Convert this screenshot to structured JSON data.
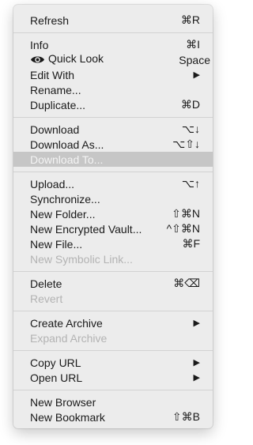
{
  "menu": {
    "refresh": {
      "label": "Refresh",
      "shortcut": "⌘R"
    },
    "info": {
      "label": "Info",
      "shortcut": "⌘I"
    },
    "quick_look": {
      "label": "Quick Look",
      "shortcut": "Space",
      "icon": "eye-icon"
    },
    "edit_with": {
      "label": "Edit With",
      "submenu_icon": "chevron-right-icon"
    },
    "rename": {
      "label": "Rename..."
    },
    "duplicate": {
      "label": "Duplicate...",
      "shortcut": "⌘D"
    },
    "download": {
      "label": "Download",
      "shortcut": "⌥↓"
    },
    "download_as": {
      "label": "Download As...",
      "shortcut": "⌥⇧↓"
    },
    "download_to": {
      "label": "Download To...",
      "state": "highlighted-disabled"
    },
    "upload": {
      "label": "Upload...",
      "shortcut": "⌥↑"
    },
    "synchronize": {
      "label": "Synchronize..."
    },
    "new_folder": {
      "label": "New Folder...",
      "shortcut": "⇧⌘N"
    },
    "new_encrypted_vault": {
      "label": "New Encrypted Vault...",
      "shortcut": "^⇧⌘N"
    },
    "new_file": {
      "label": "New File...",
      "shortcut": "⌘F"
    },
    "new_symbolic_link": {
      "label": "New Symbolic Link...",
      "state": "disabled"
    },
    "delete": {
      "label": "Delete",
      "shortcut": "⌘⌫"
    },
    "revert": {
      "label": "Revert",
      "state": "disabled"
    },
    "create_archive": {
      "label": "Create Archive",
      "submenu_icon": "chevron-right-icon"
    },
    "expand_archive": {
      "label": "Expand Archive",
      "state": "disabled"
    },
    "copy_url": {
      "label": "Copy URL",
      "submenu_icon": "chevron-right-icon"
    },
    "open_url": {
      "label": "Open URL",
      "submenu_icon": "chevron-right-icon"
    },
    "new_browser": {
      "label": "New Browser"
    },
    "new_bookmark": {
      "label": "New Bookmark",
      "shortcut": "⇧⌘B"
    }
  },
  "colors": {
    "menu_bg": "#ececec",
    "text": "#1a1a1a",
    "disabled_text": "#b3b3b3",
    "highlight_bg": "#c6c6c6",
    "separator": "#d2d2d2"
  }
}
